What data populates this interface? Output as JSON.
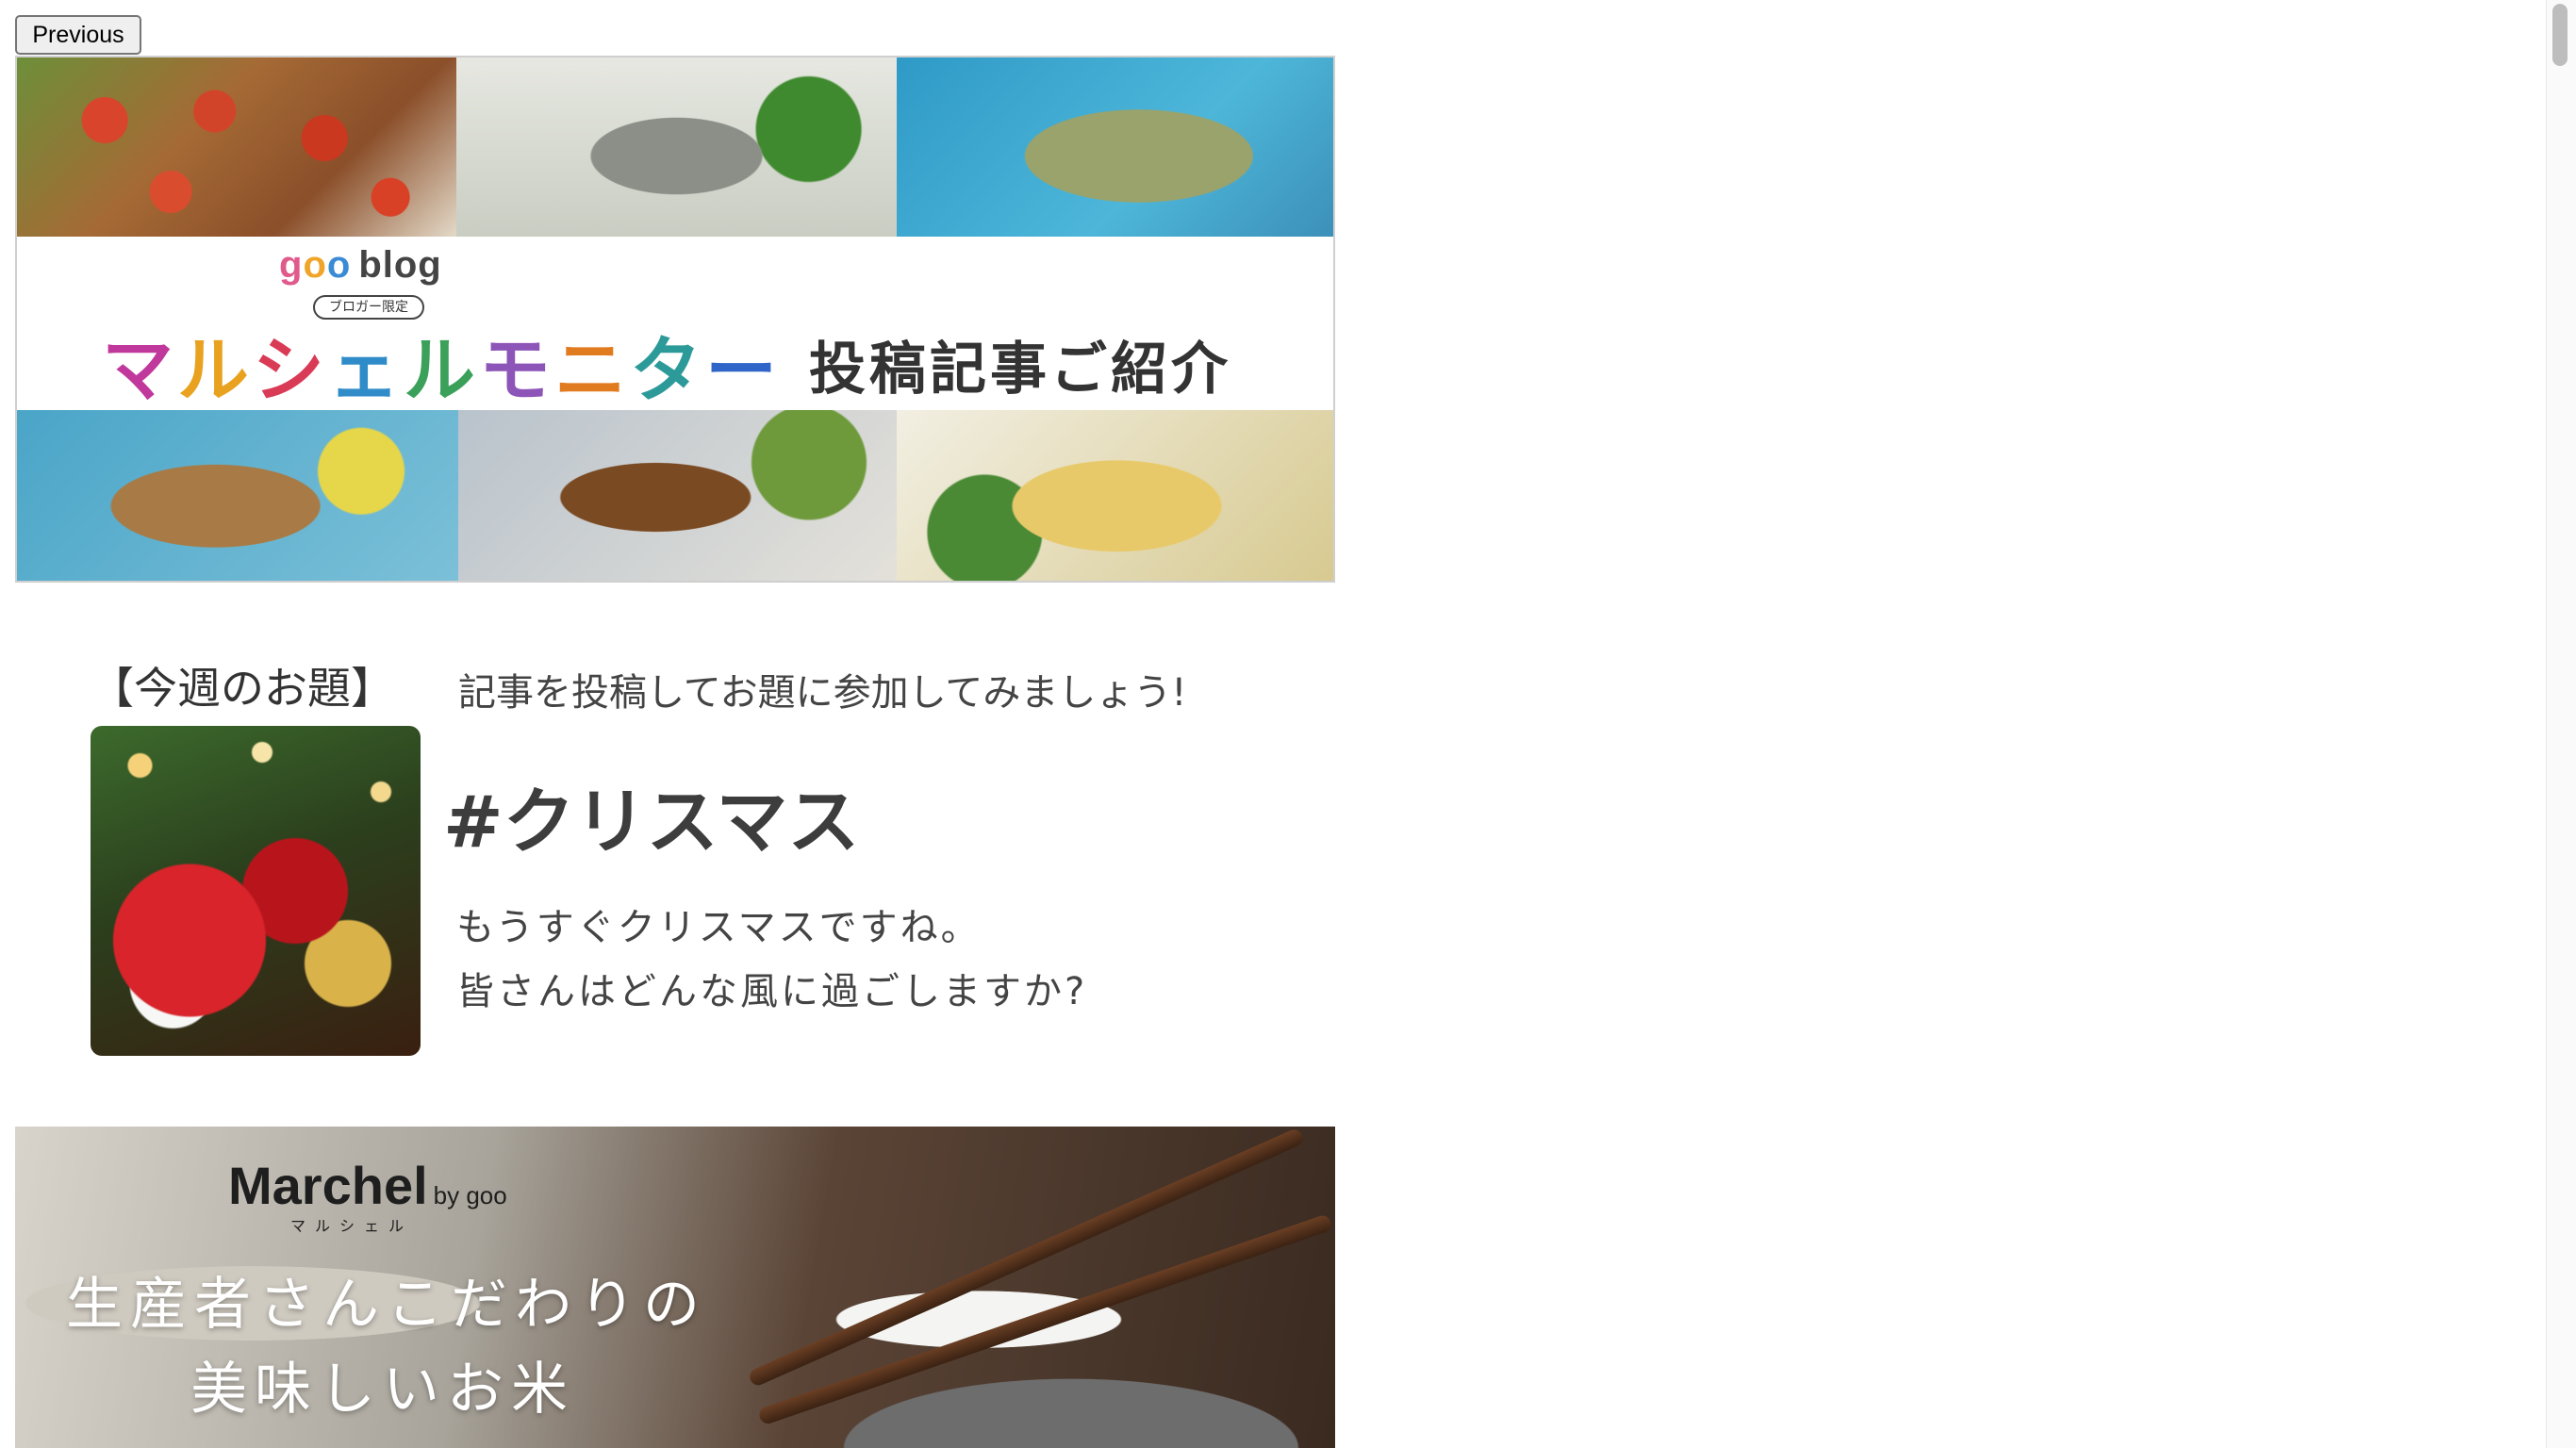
{
  "nav": {
    "previous_label": "Previous"
  },
  "banner_monitor": {
    "logo_goo": [
      "g",
      "o",
      "o"
    ],
    "logo_blog": "blog",
    "badge": "ブロガー限定",
    "title_chars": [
      "マ",
      "ル",
      "シ",
      "ェ",
      "ル",
      "モ",
      "ニ",
      "タ",
      "ー"
    ],
    "subtitle": "投稿記事ご紹介",
    "photos": [
      "tomato-eggplant-dish",
      "grilled-fish-dish",
      "asparagus-salad-dish",
      "fried-asparagus-dish",
      "eggplant-sauce-dish",
      "asparagus-egg-dish"
    ]
  },
  "topic": {
    "label": "【今週のお題】",
    "invite": "記事を投稿してお題に参加してみましょう!",
    "hashtag": "#クリスマス",
    "description_line1": "もうすぐクリスマスですね。",
    "description_line2": "皆さんはどんな風に過ごしますか?"
  },
  "banner_rice": {
    "brand": "Marchel",
    "brand_suffix": "by goo",
    "brand_kana": "マルシェル",
    "line1": "生産者さんこだわりの",
    "line2": "美味しいお米"
  },
  "colors": {
    "page_bg": "#ffffff",
    "button_bg": "#efefef",
    "button_border": "#767676"
  }
}
